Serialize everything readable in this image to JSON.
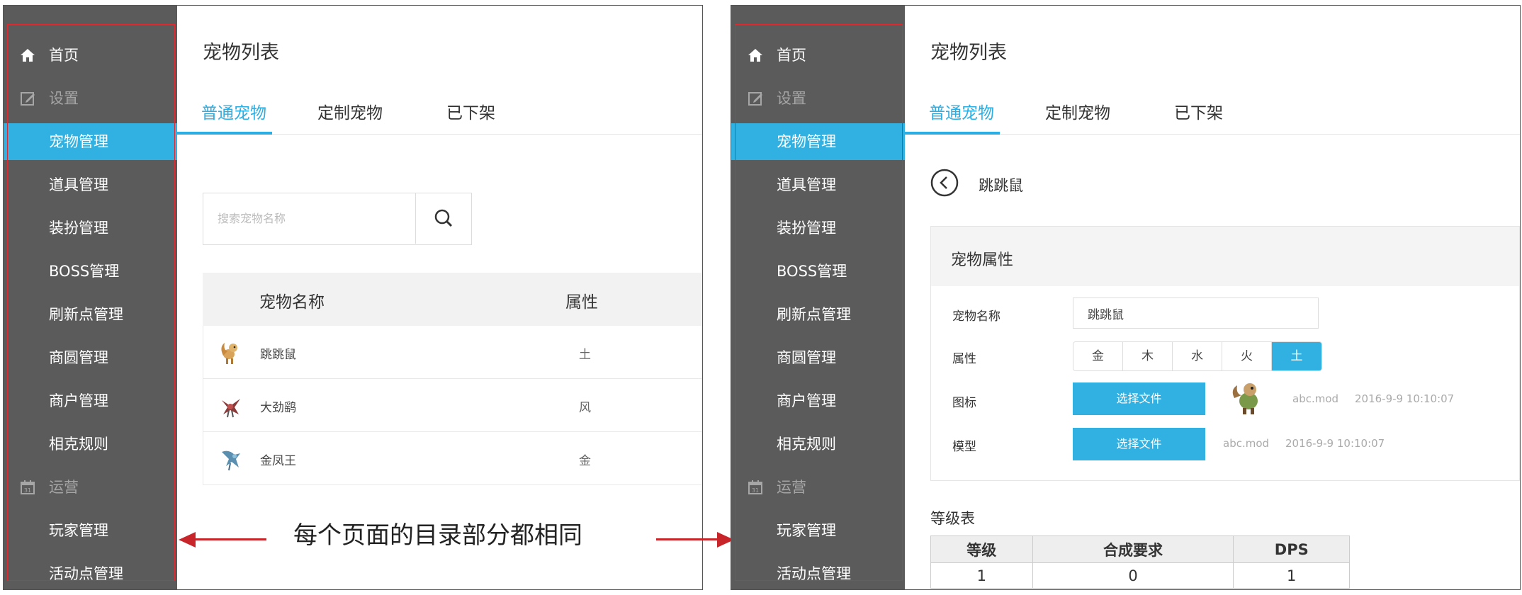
{
  "sidebar": {
    "items": [
      {
        "label": "首页",
        "icon": "home-icon",
        "kind": "top"
      },
      {
        "label": "设置",
        "icon": "edit-icon",
        "kind": "group"
      },
      {
        "label": "宠物管理",
        "kind": "sub",
        "active": true
      },
      {
        "label": "道具管理",
        "kind": "sub"
      },
      {
        "label": "装扮管理",
        "kind": "sub"
      },
      {
        "label": "BOSS管理",
        "kind": "sub"
      },
      {
        "label": "刷新点管理",
        "kind": "sub"
      },
      {
        "label": "商圆管理",
        "kind": "sub"
      },
      {
        "label": "商户管理",
        "kind": "sub"
      },
      {
        "label": "相克规则",
        "kind": "sub"
      },
      {
        "label": "运营",
        "icon": "calendar-icon",
        "kind": "group"
      },
      {
        "label": "玩家管理",
        "kind": "sub"
      },
      {
        "label": "活动点管理",
        "kind": "sub"
      }
    ]
  },
  "page": {
    "title": "宠物列表",
    "tabs": [
      "普通宠物",
      "定制宠物",
      "已下架"
    ]
  },
  "list_view": {
    "search_placeholder": "搜索宠物名称",
    "columns": [
      "宠物名称",
      "属性"
    ],
    "rows": [
      {
        "name": "跳跳鼠",
        "attr": "土",
        "icon": "squirrel-pet-icon"
      },
      {
        "name": "大劲鹞",
        "attr": "风",
        "icon": "bird-pet-icon"
      },
      {
        "name": "金凤王",
        "attr": "金",
        "icon": "phoenix-pet-icon"
      }
    ]
  },
  "annotation": "每个页面的目录部分都相同",
  "detail_view": {
    "pet_name": "跳跳鼠",
    "section_title": "宠物属性",
    "labels": {
      "name": "宠物名称",
      "attr": "属性",
      "icon": "图标",
      "model": "模型"
    },
    "name_value": "跳跳鼠",
    "attributes": [
      "金",
      "木",
      "水",
      "火",
      "土"
    ],
    "selected_attribute": "土",
    "icon_file": {
      "button": "选择文件",
      "filename": "abc.mod",
      "time": "2016-9-9 10:10:07"
    },
    "model_file": {
      "button": "选择文件",
      "filename": "abc.mod",
      "time": "2016-9-9 10:10:07"
    },
    "level_table": {
      "title": "等级表",
      "headers": [
        "等级",
        "合成要求",
        "DPS"
      ],
      "rows": [
        [
          "1",
          "0",
          "1"
        ]
      ]
    }
  },
  "colors": {
    "sidebar_bg": "#5b5b5b",
    "accent": "#30b1e2",
    "outline": "#e0282e",
    "arrow": "#c8252b"
  }
}
